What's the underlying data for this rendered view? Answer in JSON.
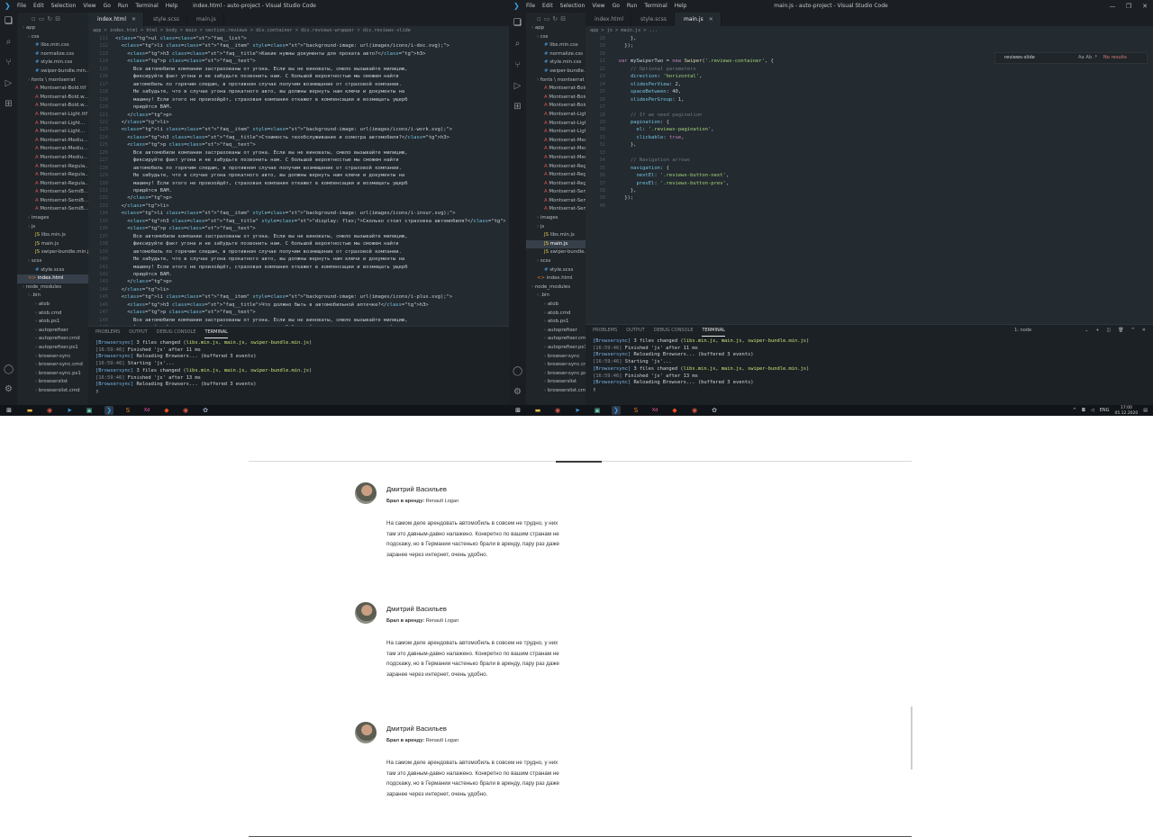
{
  "screen": {
    "menu": [
      "File",
      "Edit",
      "Selection",
      "View",
      "Go",
      "Run",
      "Terminal",
      "Help"
    ],
    "left_window": {
      "title": "index.html - auto-project - Visual Studio Code",
      "tabs": [
        {
          "label": "index.html",
          "active": true
        },
        {
          "label": "style.scss",
          "active": false
        },
        {
          "label": "main.js",
          "active": false
        }
      ],
      "breadcrumb": "app  >  index.html  >  html  >  body  >  main  >  section.reviews  >  div.container  >  div.reviews-wrapper  >  div.reviews-slide",
      "tree": [
        {
          "t": "app",
          "d": 0,
          "i": "d"
        },
        {
          "t": "css",
          "d": 1,
          "i": "d"
        },
        {
          "t": "libs.min.css",
          "d": 2,
          "i": "css"
        },
        {
          "t": "normalize.css",
          "d": 2,
          "i": "css"
        },
        {
          "t": "style.min.css",
          "d": 2,
          "i": "css"
        },
        {
          "t": "swiper-bundle.min...",
          "d": 2,
          "i": "css"
        },
        {
          "t": "fonts \\ montserrat",
          "d": 1,
          "i": "d"
        },
        {
          "t": "Montserrat-Bold.ttf",
          "d": 2,
          "i": "f"
        },
        {
          "t": "Montserrat-Bold.w...",
          "d": 2,
          "i": "f"
        },
        {
          "t": "Montserrat-Bold.w...",
          "d": 2,
          "i": "f"
        },
        {
          "t": "Montserrat-Light.ttf",
          "d": 2,
          "i": "f"
        },
        {
          "t": "Montserrat-Light...",
          "d": 2,
          "i": "f"
        },
        {
          "t": "Montserrat-Light...",
          "d": 2,
          "i": "f"
        },
        {
          "t": "Montserrat-Mediu...",
          "d": 2,
          "i": "f"
        },
        {
          "t": "Montserrat-Mediu...",
          "d": 2,
          "i": "f"
        },
        {
          "t": "Montserrat-Mediu...",
          "d": 2,
          "i": "f"
        },
        {
          "t": "Montserrat-Regula...",
          "d": 2,
          "i": "f"
        },
        {
          "t": "Montserrat-Regula...",
          "d": 2,
          "i": "f"
        },
        {
          "t": "Montserrat-Regula...",
          "d": 2,
          "i": "f"
        },
        {
          "t": "Montserrat-SemiB...",
          "d": 2,
          "i": "f"
        },
        {
          "t": "Montserrat-SemiB...",
          "d": 2,
          "i": "f"
        },
        {
          "t": "Montserrat-SemiB...",
          "d": 2,
          "i": "f"
        },
        {
          "t": "images",
          "d": 1,
          "i": "d"
        },
        {
          "t": "js",
          "d": 1,
          "i": "d"
        },
        {
          "t": "libs.min.js",
          "d": 2,
          "i": "js"
        },
        {
          "t": "main.js",
          "d": 2,
          "i": "js"
        },
        {
          "t": "swiper-bundle.min.js",
          "d": 2,
          "i": "js"
        },
        {
          "t": "scss",
          "d": 1,
          "i": "d"
        },
        {
          "t": "style.scss",
          "d": 2,
          "i": "css"
        },
        {
          "t": "index.html",
          "d": 1,
          "i": "h",
          "sel": true
        },
        {
          "t": "node_modules",
          "d": 0,
          "i": "d"
        },
        {
          "t": ".bin",
          "d": 1,
          "i": "d"
        },
        {
          "t": "atob",
          "d": 2,
          "i": "d"
        },
        {
          "t": "atob.cmd",
          "d": 2,
          "i": "d"
        },
        {
          "t": "atob.ps1",
          "d": 2,
          "i": "d"
        },
        {
          "t": "autoprefixer",
          "d": 2,
          "i": "d"
        },
        {
          "t": "autoprefixer.cmd",
          "d": 2,
          "i": "d"
        },
        {
          "t": "autoprefixer.ps1",
          "d": 2,
          "i": "d"
        },
        {
          "t": "browser-sync",
          "d": 2,
          "i": "d"
        },
        {
          "t": "browser-sync.cmd",
          "d": 2,
          "i": "d"
        },
        {
          "t": "browser-sync.ps1",
          "d": 2,
          "i": "d"
        },
        {
          "t": "browserslist",
          "d": 2,
          "i": "d"
        },
        {
          "t": "browserslist.cmd",
          "d": 2,
          "i": "d"
        }
      ],
      "line_start": 111,
      "code": [
        "<ul class=\"faq__list\">",
        "  <li class=\"faq__item\" style=\"background-image: url(images/icons/i-doc.svg);\">",
        "    <h3 class=\"faq__title\">Какие нужны документы для проката авто?</h3>",
        "    <p class=\"faq__text\">",
        "      Все автомобили компании застрахованы от угона. Если вы не виноваты, смело вызывайте милицию,",
        "      фиксируйте факт угона и не забудьте позвонить нам. С большой вероятностью мы сможем найти",
        "      автомобиль по горячим следам, в противном случае получим возмещение от страховой компании.",
        "      Не забудьте, что в случае угона прокатного авто, вы должны вернуть нам ключи и документы на",
        "      машину! Если этого не произойдёт, страховая компания откажет в компенсации и возмещать ущерб",
        "      придётся ВАМ.",
        "    </p>",
        "  </li>",
        "  <li class=\"faq__item\" style=\"background-image: url(images/icons/i-work.svg);\">",
        "    <h3 class=\"faq__title\">Стоимость техобслуживания и осмотра автомобиля?</h3>",
        "    <p class=\"faq__text\">",
        "      Все автомобили компании застрахованы от угона. Если вы не виноваты, смело вызывайте милицию,",
        "      фиксируйте факт угона и не забудьте позвонить нам. С большой вероятностью мы сможем найти",
        "      автомобиль по горячим следам, в противном случае получим возмещение от страховой компании.",
        "      Не забудьте, что в случае угона прокатного авто, вы должны вернуть нам ключи и документы на",
        "      машину! Если этого не произойдёт, страховая компания откажет в компенсации и возмещать ущерб",
        "      придётся ВАМ.",
        "    </p>",
        "  </li>",
        "  <li class=\"faq__item\" style=\"background-image: url(images/icons/i-insur.svg);\">",
        "    <h3 class=\"faq__title\" style=\"display: flex;\">Сколько стоит страховка автомобиля?</h3>",
        "    <p class=\"faq__text\">",
        "      Все автомобили компании застрахованы от угона. Если вы не виноваты, смело вызывайте милицию,",
        "      фиксируйте факт угона и не забудьте позвонить нам. С большой вероятностью мы сможем найти",
        "      автомобиль по горячим следам, в противном случае получим возмещение от страховой компании.",
        "      Не забудьте, что в случае угона прокатного авто, вы должны вернуть нам ключи и документы на",
        "      машину! Если этого не произойдёт, страховая компания откажет в компенсации и возмещать ущерб",
        "      придётся ВАМ.",
        "    </p>",
        "  </li>",
        "  <li class=\"faq__item\" style=\"background-image: url(images/icons/i-plus.svg);\">",
        "    <h3 class=\"faq__title\">Что должно быть в автомобильной аптечке?</h3>",
        "    <p class=\"faq__text\">",
        "      Все автомобили компании застрахованы от угона. Если вы не виноваты, смело вызывайте милицию,",
        "      фиксируйте факт угона и не забудьте позвонить нам. С большой вероятностью мы сможем найти"
      ],
      "panel_tabs": [
        "PROBLEMS",
        "OUTPUT",
        "DEBUG CONSOLE",
        "TERMINAL"
      ],
      "terminal": [
        "[Browsersync] 3 files changed (libs.min.js, main.js, swiper-bundle.min.js)",
        "[16:59:46] Finished 'js' after 11 ms",
        "[Browsersync] Reloading Browsers... (buffered 3 events)",
        "[16:59:46] Starting 'js'...",
        "[Browsersync] 3 files changed (libs.min.js, main.js, swiper-bundle.min.js)",
        "[16:59:46] Finished 'js' after 13 ms",
        "[Browsersync] Reloading Browsers... (buffered 3 events)"
      ]
    },
    "right_window": {
      "title": "main.js - auto-project - Visual Studio Code",
      "tabs": [
        {
          "label": "index.html",
          "active": false
        },
        {
          "label": "style.scss",
          "active": false
        },
        {
          "label": "main.js",
          "active": true
        }
      ],
      "breadcrumb": "app  >  js  >  main.js  >  ...",
      "find": {
        "value": "reviews-slide",
        "result": "No results",
        "options": "Aa  Ab  .*"
      },
      "tree": [
        {
          "t": "app",
          "d": 0,
          "i": "d"
        },
        {
          "t": "css",
          "d": 1,
          "i": "d"
        },
        {
          "t": "libs.min.css",
          "d": 2,
          "i": "css"
        },
        {
          "t": "normalize.css",
          "d": 2,
          "i": "css"
        },
        {
          "t": "style.min.css",
          "d": 2,
          "i": "css"
        },
        {
          "t": "swiper-bundle.min...",
          "d": 2,
          "i": "css"
        },
        {
          "t": "fonts \\ montserrat",
          "d": 1,
          "i": "d"
        },
        {
          "t": "Montserrat-Bold.ttf",
          "d": 2,
          "i": "f"
        },
        {
          "t": "Montserrat-Bold.w...",
          "d": 2,
          "i": "f"
        },
        {
          "t": "Montserrat-Bold.w...",
          "d": 2,
          "i": "f"
        },
        {
          "t": "Montserrat-Light.ttf",
          "d": 2,
          "i": "f"
        },
        {
          "t": "Montserrat-Light...",
          "d": 2,
          "i": "f"
        },
        {
          "t": "Montserrat-Light...",
          "d": 2,
          "i": "f"
        },
        {
          "t": "Montserrat-Mediu...",
          "d": 2,
          "i": "f"
        },
        {
          "t": "Montserrat-Mediu...",
          "d": 2,
          "i": "f"
        },
        {
          "t": "Montserrat-Mediu...",
          "d": 2,
          "i": "f"
        },
        {
          "t": "Montserrat-Regula...",
          "d": 2,
          "i": "f"
        },
        {
          "t": "Montserrat-Regula...",
          "d": 2,
          "i": "f"
        },
        {
          "t": "Montserrat-Regula...",
          "d": 2,
          "i": "f"
        },
        {
          "t": "Montserrat-SemiB...",
          "d": 2,
          "i": "f"
        },
        {
          "t": "Montserrat-SemiB...",
          "d": 2,
          "i": "f"
        },
        {
          "t": "Montserrat-SemiB...",
          "d": 2,
          "i": "f"
        },
        {
          "t": "images",
          "d": 1,
          "i": "d"
        },
        {
          "t": "js",
          "d": 1,
          "i": "d"
        },
        {
          "t": "libs.min.js",
          "d": 2,
          "i": "js"
        },
        {
          "t": "main.js",
          "d": 2,
          "i": "js",
          "sel": true
        },
        {
          "t": "swiper-bundle.min.js",
          "d": 2,
          "i": "js"
        },
        {
          "t": "scss",
          "d": 1,
          "i": "d"
        },
        {
          "t": "style.scss",
          "d": 2,
          "i": "css"
        },
        {
          "t": "index.html",
          "d": 1,
          "i": "h"
        },
        {
          "t": "node_modules",
          "d": 0,
          "i": "d"
        },
        {
          "t": ".bin",
          "d": 1,
          "i": "d"
        },
        {
          "t": "atob",
          "d": 2,
          "i": "d"
        },
        {
          "t": "atob.cmd",
          "d": 2,
          "i": "d"
        },
        {
          "t": "atob.ps1",
          "d": 2,
          "i": "d"
        },
        {
          "t": "autoprefixer",
          "d": 2,
          "i": "d"
        },
        {
          "t": "autoprefixer.cmd",
          "d": 2,
          "i": "d"
        },
        {
          "t": "autoprefixer.ps1",
          "d": 2,
          "i": "d"
        },
        {
          "t": "browser-sync",
          "d": 2,
          "i": "d"
        },
        {
          "t": "browser-sync.cmd",
          "d": 2,
          "i": "d"
        },
        {
          "t": "browser-sync.ps1",
          "d": 2,
          "i": "d"
        },
        {
          "t": "browserslist",
          "d": 2,
          "i": "d"
        },
        {
          "t": "browserslist.cmd",
          "d": 2,
          "i": "d"
        }
      ],
      "line_start": 18,
      "code": [
        "      },",
        "    });",
        "",
        "  var mySwiperTwo = new Swiper('.reviews-container', {",
        "      // Optional parameters",
        "      direction: 'horizontal',",
        "      slidesPerView: 2,",
        "      spaceBetween: 40,",
        "      slidesPerGroup: 1,",
        "",
        "      // If we need pagination",
        "      pagination: {",
        "        el: '.reviews-pagination',",
        "        clickable: true,",
        "      },",
        "",
        "      // Navigation arrows",
        "      navigation: {",
        "        nextEl: '.reviews-button-next',",
        "        prevEl: '.reviews-button-prev',",
        "      },",
        "    });",
        "    "
      ],
      "panel_tabs": [
        "PROBLEMS",
        "OUTPUT",
        "DEBUG CONSOLE",
        "TERMINAL"
      ],
      "terminal_select": "1: node",
      "terminal": [
        "[Browsersync] 3 files changed (libs.min.js, main.js, swiper-bundle.min.js)",
        "[16:59:46] Finished 'js' after 11 ms",
        "[Browsersync] Reloading Browsers... (buffered 3 events)",
        "[16:59:46] Starting 'js'...",
        "[Browsersync] 3 files changed (libs.min.js, main.js, swiper-bundle.min.js)",
        "[16:59:46] Finished 'js' after 13 ms",
        "[Browsersync] Reloading Browsers... (buffered 3 events)"
      ]
    },
    "tray": {
      "lang": "ENG",
      "time": "17:00",
      "date": "05.12.2020"
    }
  },
  "reviews": [
    {
      "name": "Дмитрий Васильев",
      "car_label": "Брал в аренду:",
      "car": "Renault Logan",
      "text": "На самом деле арендовать автомобиль в совсем не трудно, у них там это давным-давно налажено. Конкретно по вашим странам не подскажу, но в Германии частенько брали в аренду, пару раз даже заранее через интернет, очень удобно."
    },
    {
      "name": "Дмитрий Васильев",
      "car_label": "Брал в аренду:",
      "car": "Renault Logan",
      "text": "На самом деле арендовать автомобиль в совсем не трудно, у них там это давным-давно налажено. Конкретно по вашим странам не подскажу, но в Германии частенько брали в аренду, пару раз даже заранее через интернет, очень удобно."
    },
    {
      "name": "Дмитрий Васильев",
      "car_label": "Брал в аренду:",
      "car": "Renault Logan",
      "text": "На самом деле арендовать автомобиль в совсем не трудно, у них там это давным-давно налажено. Конкретно по вашим странам не подскажу, но в Германии частенько брали в аренду, пару раз даже заранее через интернет, очень удобно."
    }
  ]
}
